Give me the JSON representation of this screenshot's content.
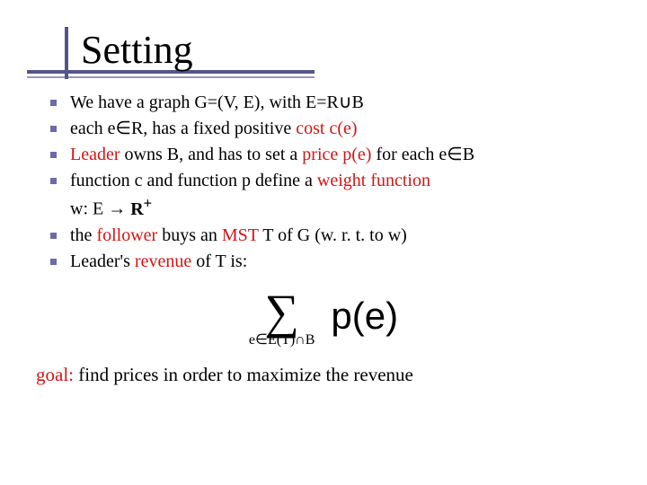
{
  "title": "Setting",
  "bullets": {
    "b1a": "We have a graph G=(V, E), with E=R",
    "b1b": "B",
    "b2a": "each e",
    "b2b": "R, has a fixed positive ",
    "b2c": "cost c(e)",
    "b3a": "Leader",
    "b3b": " owns B, and has to set a ",
    "b3c": "price p(e)",
    "b3d": " for each e",
    "b3e": "B",
    "b4a": "function c and function p define a ",
    "b4b": "weight function",
    "b4c": "w: E ",
    "b4d": " R",
    "b4sup": "+",
    "b5a": "the ",
    "b5b": "follower",
    "b5c": " buys an ",
    "b5d": "MST",
    "b5e": " T of G (w. r. t. to w)",
    "b6a": "Leader's ",
    "b6b": "revenue",
    "b6c": " of T is:"
  },
  "formula": {
    "sigma": "∑",
    "subscript_a": "e",
    "subscript_b": "E(T)",
    "subscript_c": "B",
    "main": "p(e)"
  },
  "goal": {
    "a": "goal:",
    "b": " find prices in order to maximize the revenue"
  },
  "symbols": {
    "union": "∪",
    "elem": "∈",
    "arrow": "→",
    "inter": "∩"
  }
}
